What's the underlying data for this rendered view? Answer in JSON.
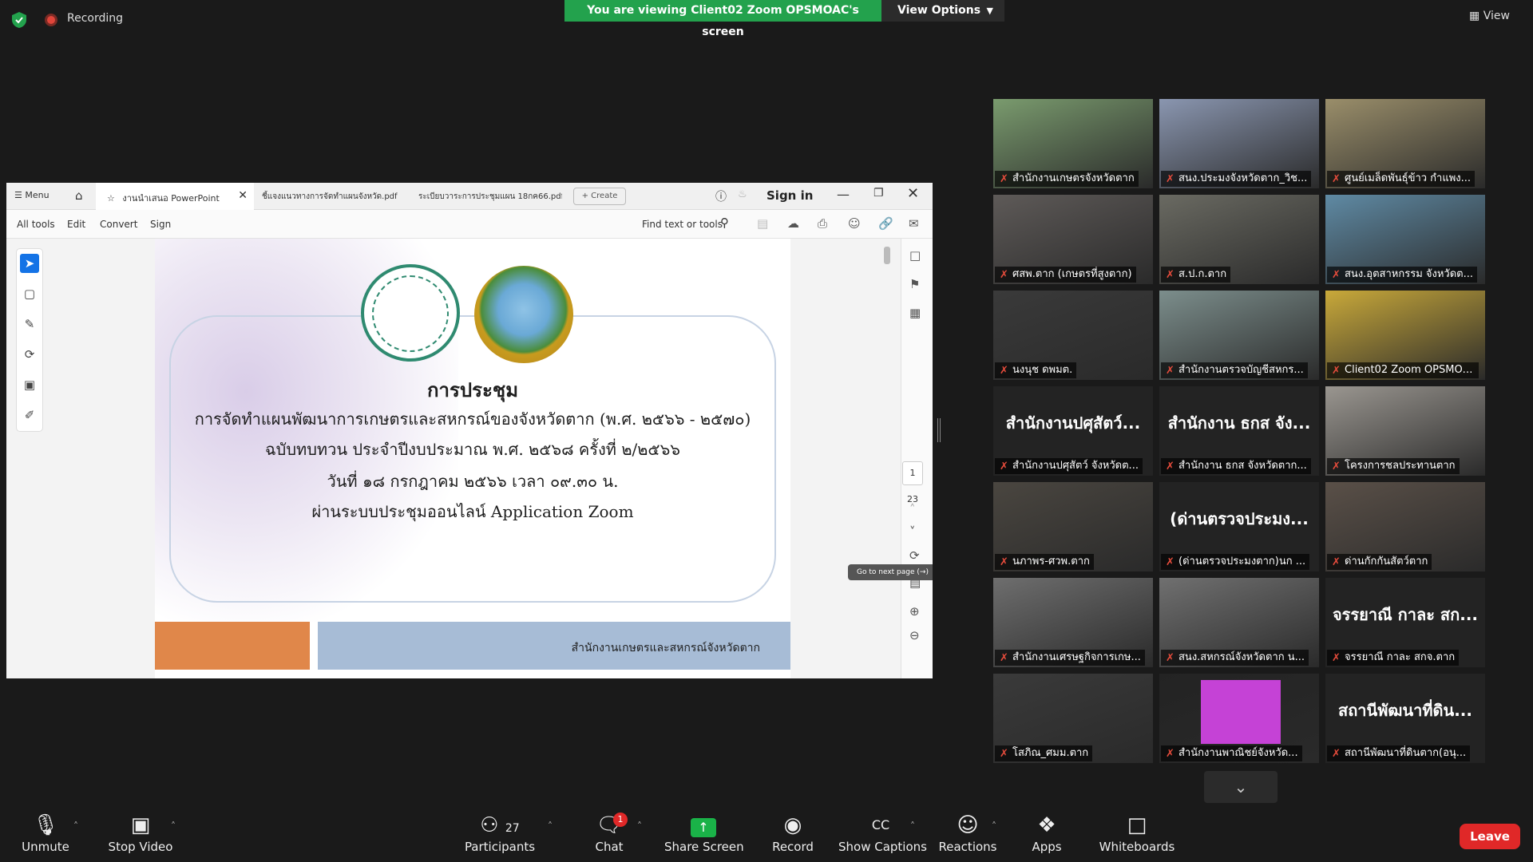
{
  "topbar": {
    "recording_label": "Recording",
    "viewing_banner": "You are viewing Client02 Zoom OPSMOAC's screen",
    "view_options_label": "View Options",
    "view_label": "View"
  },
  "share": {
    "menu_label": "Menu",
    "tabs": [
      {
        "label": "งานนำเสนอ PowerPoint"
      },
      {
        "label": "ชี้แจงแนวทางการจัดทำแผนจังหวัด.pdf"
      },
      {
        "label": "ระเบียบวาระการประชุมแผน 18กค66.pdf"
      }
    ],
    "create_label": "Create",
    "sign_in_label": "Sign in",
    "toolbar": {
      "all_tools": "All tools",
      "edit": "Edit",
      "convert": "Convert",
      "sign": "Sign",
      "find": "Find text or tools"
    },
    "slide": {
      "title": "การประชุม",
      "line2": "การจัดทำแผนพัฒนาการเกษตรและสหกรณ์ของจังหวัดตาก (พ.ศ. ๒๕๖๖ - ๒๕๗๐)",
      "line3": "ฉบับทบทวน ประจำปีงบประมาณ พ.ศ. ๒๕๖๘ ครั้งที่ ๒/๒๕๖๖",
      "line4": "วันที่ ๑๘ กรกฎาคม ๒๕๖๖ เวลา ๐๙.๓๐ น.",
      "line5": "ผ่านระบบประชุมออนไลน์ Application Zoom",
      "footer": "สำนักงานเกษตรและสหกรณ์จังหวัดตาก"
    },
    "current_page": "1",
    "total_pages": "23",
    "tooltip": "Go to next page (→)"
  },
  "gallery": [
    {
      "name": "สำนักงานเกษตรจังหวัดตาก",
      "display": "",
      "color": "#7a9b6e"
    },
    {
      "name": "สนง.ประมงจังหวัดตาก_วิช...",
      "display": "",
      "color": "#8a96b0"
    },
    {
      "name": "ศูนย์เมล็ดพันธุ์ข้าว กำแพง...",
      "display": "",
      "color": "#9a8e6a"
    },
    {
      "name": "ศสพ.ตาก (เกษตรที่สูงตาก)",
      "display": "",
      "color": "#5e5a58"
    },
    {
      "name": "ส.ป.ก.ตาก",
      "display": "",
      "color": "#6a6a62"
    },
    {
      "name": "สนง.อุตสาหกรรม จังหวัดต...",
      "display": "",
      "color": "#5f8aa4"
    },
    {
      "name": "นงนุช ดพมต.",
      "display": "",
      "color": "#3a3a3a"
    },
    {
      "name": "สำนักงานตรวจบัญชีสหกร...",
      "display": "",
      "color": "#7c8e8c"
    },
    {
      "name": "Client02 Zoom OPSMOAC",
      "display": "",
      "color": "#c9a93a"
    },
    {
      "name": "สำนักงานปศุสัตว์ จังหวัดต...",
      "display": "สำนักงานปศุสัตว์...",
      "color": "#232323"
    },
    {
      "name": "สำนักงาน ธกส จังหวัดตาก...",
      "display": "สำนักงาน ธกส จัง...",
      "color": "#232323"
    },
    {
      "name": "โครงการชลประทานตาก",
      "display": "",
      "color": "#9a9690"
    },
    {
      "name": "นภาพร-ศวพ.ตาก",
      "display": "",
      "color": "#4a4640"
    },
    {
      "name": "(ด่านตรวจประมงตาก)นก ...",
      "display": "(ด่านตรวจประมง...",
      "color": "#232323"
    },
    {
      "name": "ด่านกักกันสัตว์ตาก",
      "display": "",
      "color": "#5a5048"
    },
    {
      "name": "สำนักงานเศรษฐกิจการเกษ...",
      "display": "",
      "color": "#6e6e6e"
    },
    {
      "name": "สนง.สหกรณ์จังหวัดตาก น...",
      "display": "",
      "color": "#707070"
    },
    {
      "name": "จรรยาณี กาละ สกจ.ตาก",
      "display": "จรรยาณี กาละ สก...",
      "color": "#232323"
    },
    {
      "name": "โสภิณ_ศมม.ตาก",
      "display": "",
      "color": "#3a3a3a"
    },
    {
      "name": "สำนักงานพาณิชย์จังหวัด...",
      "display": "",
      "color": "#232323"
    },
    {
      "name": "สถานีพัฒนาที่ดินตาก(อนุ...",
      "display": "สถานีพัฒนาที่ดิน...",
      "color": "#232323"
    }
  ],
  "controls": {
    "unmute": "Unmute",
    "stop_video": "Stop Video",
    "participants": "Participants",
    "participants_count": "27",
    "chat": "Chat",
    "chat_badge": "1",
    "share_screen": "Share Screen",
    "record": "Record",
    "show_captions": "Show Captions",
    "reactions": "Reactions",
    "apps": "Apps",
    "whiteboards": "Whiteboards",
    "leave": "Leave"
  }
}
